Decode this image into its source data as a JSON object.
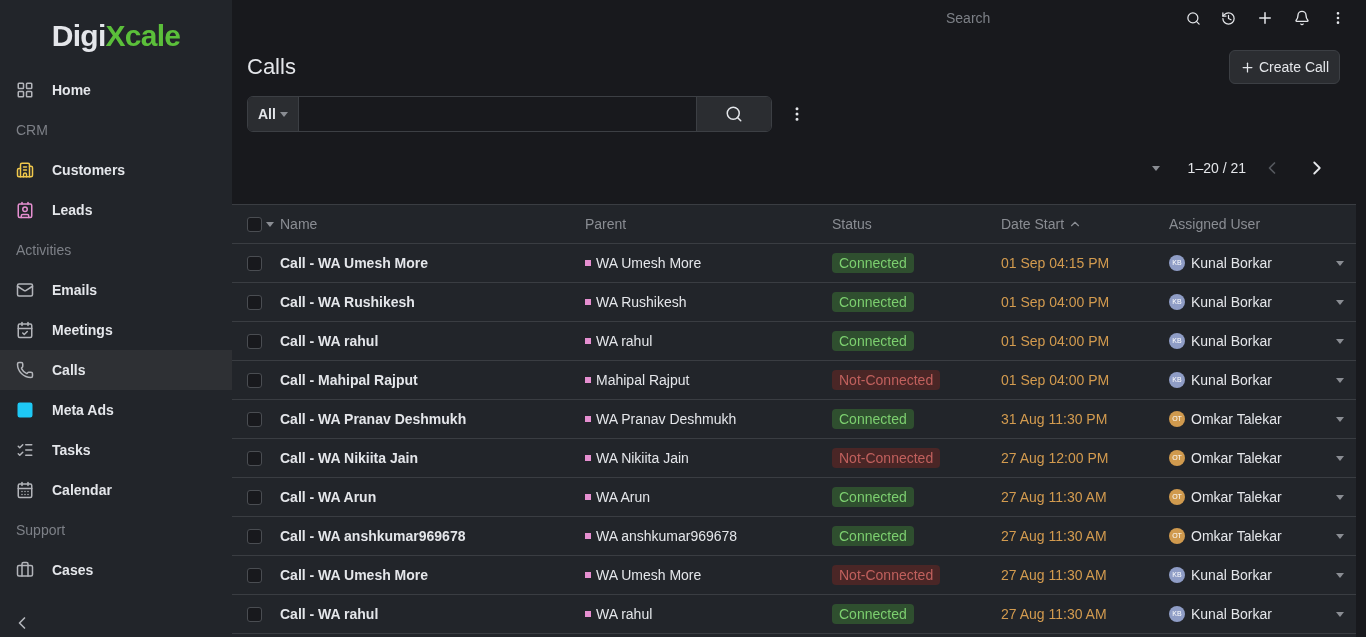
{
  "logo": {
    "part1": "Digi",
    "part2": "Xcale"
  },
  "sidebar": {
    "items": [
      {
        "kind": "link",
        "label": "Home",
        "selected": false
      },
      {
        "kind": "header",
        "label": "CRM"
      },
      {
        "kind": "link",
        "label": "Customers",
        "selected": false,
        "color": "#f2c94c"
      },
      {
        "kind": "link",
        "label": "Leads",
        "selected": false,
        "color": "#e58fd0"
      },
      {
        "kind": "header",
        "label": "Activities"
      },
      {
        "kind": "link",
        "label": "Emails",
        "selected": false
      },
      {
        "kind": "link",
        "label": "Meetings",
        "selected": false
      },
      {
        "kind": "link",
        "label": "Calls",
        "selected": true
      },
      {
        "kind": "link",
        "label": "Meta Ads",
        "selected": false,
        "color": "#1ec8f5"
      },
      {
        "kind": "link",
        "label": "Tasks",
        "selected": false
      },
      {
        "kind": "link",
        "label": "Calendar",
        "selected": false
      },
      {
        "kind": "header",
        "label": "Support"
      },
      {
        "kind": "link",
        "label": "Cases",
        "selected": false
      }
    ]
  },
  "topbar": {
    "search_placeholder": "Search"
  },
  "page": {
    "title": "Calls",
    "create_button": "Create Call",
    "filter": "All",
    "pagination": "1–20 / 21"
  },
  "table": {
    "select_all_checked": false,
    "columns": [
      "Name",
      "Parent",
      "Status",
      "Date Start",
      "Assigned User"
    ],
    "rows": [
      {
        "name": "Call - WA Umesh More",
        "parent": "WA Umesh More",
        "status": "Connected",
        "kind": "connected",
        "date": "01 Sep 04:15 PM",
        "user": "Kunal Borkar",
        "initials": "KB",
        "color": "#8f9dc6",
        "checked": false
      },
      {
        "name": "Call - WA Rushikesh",
        "parent": "WA Rushikesh",
        "status": "Connected",
        "kind": "connected",
        "date": "01 Sep 04:00 PM",
        "user": "Kunal Borkar",
        "initials": "KB",
        "color": "#8f9dc6",
        "checked": false
      },
      {
        "name": "Call - WA rahul",
        "parent": "WA rahul",
        "status": "Connected",
        "kind": "connected",
        "date": "01 Sep 04:00 PM",
        "user": "Kunal Borkar",
        "initials": "KB",
        "color": "#8f9dc6",
        "checked": false
      },
      {
        "name": "Call - Mahipal Rajput",
        "parent": "Mahipal Rajput",
        "status": "Not-Connected",
        "kind": "not-connected",
        "date": "01 Sep 04:00 PM",
        "user": "Kunal Borkar",
        "initials": "KB",
        "color": "#8f9dc6",
        "checked": false
      },
      {
        "name": "Call - WA Pranav Deshmukh",
        "parent": "WA Pranav Deshmukh",
        "status": "Connected",
        "kind": "connected",
        "date": "31 Aug 11:30 PM",
        "user": "Omkar Talekar",
        "initials": "OT",
        "color": "#d09a4e",
        "checked": false
      },
      {
        "name": "Call - WA Nikiita Jain",
        "parent": "WA Nikiita Jain",
        "status": "Not-Connected",
        "kind": "not-connected",
        "date": "27 Aug 12:00 PM",
        "user": "Omkar Talekar",
        "initials": "OT",
        "color": "#d09a4e",
        "checked": false
      },
      {
        "name": "Call - WA Arun",
        "parent": "WA Arun",
        "status": "Connected",
        "kind": "connected",
        "date": "27 Aug 11:30 AM",
        "user": "Omkar Talekar",
        "initials": "OT",
        "color": "#d09a4e",
        "checked": false
      },
      {
        "name": "Call - WA anshkumar969678",
        "parent": "WA anshkumar969678",
        "status": "Connected",
        "kind": "connected",
        "date": "27 Aug 11:30 AM",
        "user": "Omkar Talekar",
        "initials": "OT",
        "color": "#d09a4e",
        "checked": false
      },
      {
        "name": "Call - WA Umesh More",
        "parent": "WA Umesh More",
        "status": "Not-Connected",
        "kind": "not-connected",
        "date": "27 Aug 11:30 AM",
        "user": "Kunal Borkar",
        "initials": "KB",
        "color": "#8f9dc6",
        "checked": false
      },
      {
        "name": "Call - WA rahul",
        "parent": "WA rahul",
        "status": "Connected",
        "kind": "connected",
        "date": "27 Aug 11:30 AM",
        "user": "Kunal Borkar",
        "initials": "KB",
        "color": "#8f9dc6",
        "checked": false
      }
    ]
  }
}
